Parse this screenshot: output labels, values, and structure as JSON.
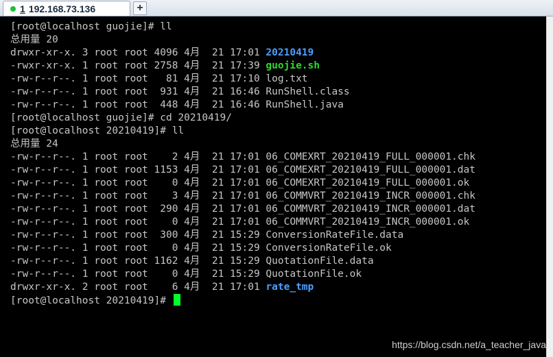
{
  "tab": {
    "number": "1",
    "host": "192.168.73.136",
    "new_tab_symbol": "+"
  },
  "terminal": {
    "lines": [
      {
        "text": "[root@localhost guojie]# ll",
        "name": ""
      },
      {
        "text": "总用量 20",
        "name": ""
      },
      {
        "text": "drwxr-xr-x. 3 root root 4096 4月  21 17:01 ",
        "name": "20210419",
        "kind": "dir"
      },
      {
        "text": "-rwxr-xr-x. 1 root root 2758 4月  21 17:39 ",
        "name": "guojie.sh",
        "kind": "exe"
      },
      {
        "text": "-rw-r--r--. 1 root root   81 4月  21 17:10 ",
        "name": "log.txt"
      },
      {
        "text": "-rw-r--r--. 1 root root  931 4月  21 16:46 ",
        "name": "RunShell.class"
      },
      {
        "text": "-rw-r--r--. 1 root root  448 4月  21 16:46 ",
        "name": "RunShell.java"
      },
      {
        "text": "[root@localhost guojie]# cd 20210419/",
        "name": ""
      },
      {
        "text": "[root@localhost 20210419]# ll",
        "name": ""
      },
      {
        "text": "总用量 24",
        "name": ""
      },
      {
        "text": "-rw-r--r--. 1 root root    2 4月  21 17:01 ",
        "name": "06_COMEXRT_20210419_FULL_000001.chk"
      },
      {
        "text": "-rw-r--r--. 1 root root 1153 4月  21 17:01 ",
        "name": "06_COMEXRT_20210419_FULL_000001.dat"
      },
      {
        "text": "-rw-r--r--. 1 root root    0 4月  21 17:01 ",
        "name": "06_COMEXRT_20210419_FULL_000001.ok"
      },
      {
        "text": "-rw-r--r--. 1 root root    3 4月  21 17:01 ",
        "name": "06_COMMVRT_20210419_INCR_000001.chk"
      },
      {
        "text": "-rw-r--r--. 1 root root  290 4月  21 17:01 ",
        "name": "06_COMMVRT_20210419_INCR_000001.dat"
      },
      {
        "text": "-rw-r--r--. 1 root root    0 4月  21 17:01 ",
        "name": "06_COMMVRT_20210419_INCR_000001.ok"
      },
      {
        "text": "-rw-r--r--. 1 root root  300 4月  21 15:29 ",
        "name": "ConversionRateFile.data"
      },
      {
        "text": "-rw-r--r--. 1 root root    0 4月  21 15:29 ",
        "name": "ConversionRateFile.ok"
      },
      {
        "text": "-rw-r--r--. 1 root root 1162 4月  21 15:29 ",
        "name": "QuotationFile.data"
      },
      {
        "text": "-rw-r--r--. 1 root root    0 4月  21 15:29 ",
        "name": "QuotationFile.ok"
      },
      {
        "text": "drwxr-xr-x. 2 root root    6 4月  21 17:01 ",
        "name": "rate_tmp",
        "kind": "dir"
      },
      {
        "text": "[root@localhost 20210419]# ",
        "name": "",
        "cursor": true
      }
    ]
  },
  "watermark": "https://blog.csdn.net/a_teacher_java",
  "colors": {
    "background": "#000000",
    "text": "#c7c7c7",
    "directory": "#4aa0ff",
    "executable": "#2bdc2b",
    "cursor": "#00ff2a",
    "status_dot": "#1fbf3a"
  }
}
